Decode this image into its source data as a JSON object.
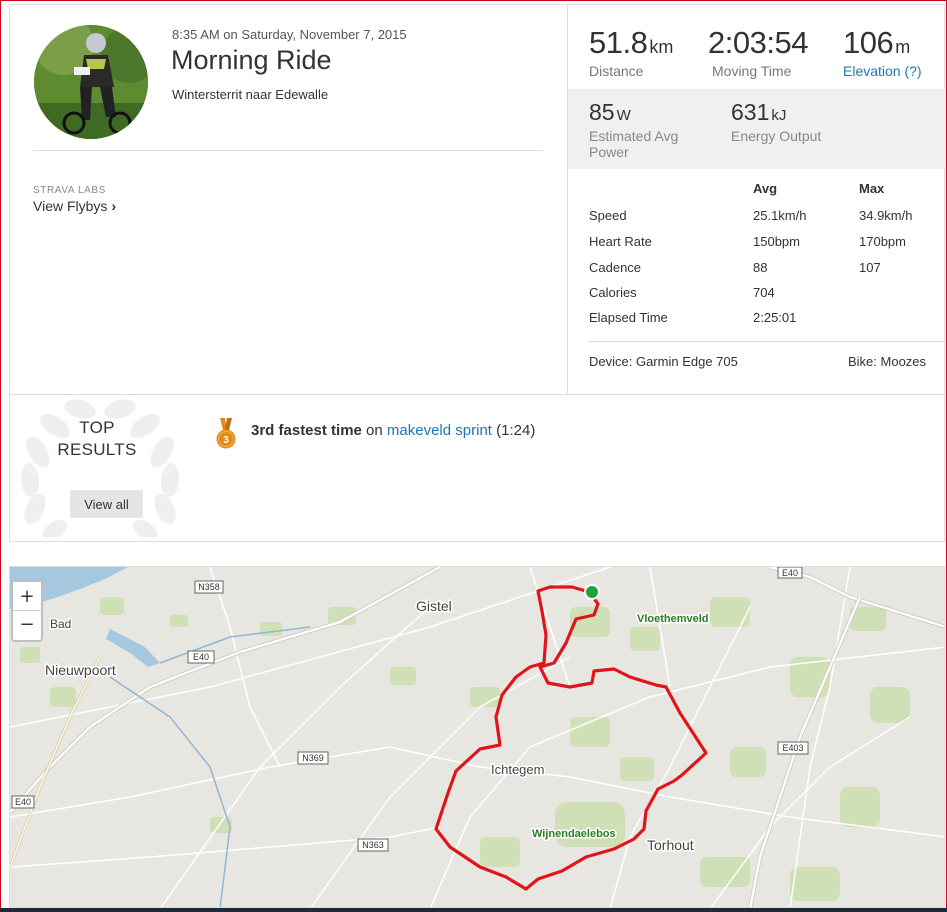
{
  "activity": {
    "datetime": "8:35 AM on Saturday, November 7, 2015",
    "title": "Morning Ride",
    "description": "Wintersterrit naar Edewalle"
  },
  "labs": {
    "kicker": "STRAVA LABS",
    "link_label": "View Flybys",
    "chevron": "›"
  },
  "stats": {
    "distance": {
      "value": "51.8",
      "unit": "km",
      "label": "Distance"
    },
    "moving_time": {
      "value": "2:03:54",
      "label": "Moving Time"
    },
    "elevation": {
      "value": "106",
      "unit": "m",
      "label": "Elevation (?)"
    },
    "power": {
      "value": "85",
      "unit": "W",
      "label": "Estimated Avg Power"
    },
    "energy": {
      "value": "631",
      "unit": "kJ",
      "label": "Energy Output"
    }
  },
  "details": {
    "avg_header": "Avg",
    "max_header": "Max",
    "rows": [
      {
        "label": "Speed",
        "avg": "25.1km/h",
        "max": "34.9km/h"
      },
      {
        "label": "Heart Rate",
        "avg": "150bpm",
        "max": "170bpm"
      },
      {
        "label": "Cadence",
        "avg": "88",
        "max": "107"
      },
      {
        "label": "Calories",
        "avg": "704",
        "max": ""
      },
      {
        "label": "Elapsed Time",
        "avg": "2:25:01",
        "max": ""
      }
    ],
    "device": "Device: Garmin Edge 705",
    "bike": "Bike: Moozes"
  },
  "top_results": {
    "title_line1": "TOP",
    "title_line2": "RESULTS",
    "view_all": "View all",
    "medal_rank": "3",
    "achievement_bold": "3rd fastest time",
    "achievement_on": "on",
    "segment_name": "makeveld sprint",
    "segment_time": "(1:24)"
  },
  "map": {
    "zoom_in": "+",
    "zoom_out": "−",
    "places": [
      "Gistel",
      "Nieuwpoort",
      "Ichtegem",
      "Torhout",
      "Vloethemveld",
      "Wijnendaelebos",
      "Bad"
    ],
    "roads": [
      "N358",
      "E40",
      "N369",
      "N363",
      "E403"
    ],
    "route_color": "#e0151b",
    "start_color": "#21a336"
  },
  "colors": {
    "link": "#1a78b6",
    "medal": "#e38a1c"
  }
}
